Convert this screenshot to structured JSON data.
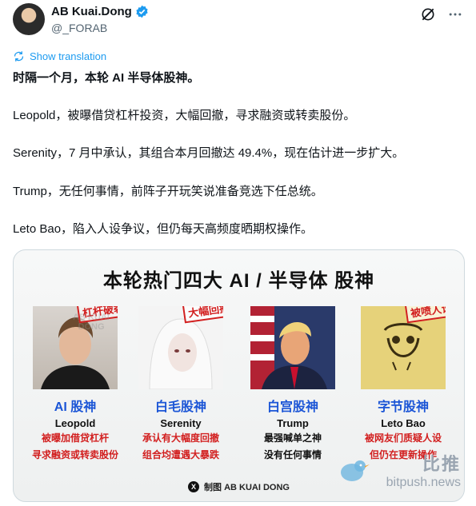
{
  "header": {
    "display_name": "AB Kuai.Dong",
    "handle": "@_FORAB"
  },
  "translation": {
    "label": "Show translation"
  },
  "tweet": {
    "lines": [
      "时隔一个月，本轮 AI 半导体股神。",
      "Leopold，被曝借贷杠杆投资，大幅回撤，寻求融资或转卖股份。",
      "Serenity，7 月中承认，其组合本月回撤达 49.4%，现在估计进一步扩大。",
      "Trump，无任何事情，前阵子开玩笑说准备竞选下任总统。",
      "Leto Bao，陷入人设争议，但仍每天高频度晒期权操作。"
    ]
  },
  "card": {
    "title": "本轮热门四大 AI / 半导体 股神",
    "people": [
      {
        "stamp": "杠杆破裂",
        "title": "AI 股神",
        "name": "Leopold",
        "desc1": "被曝加借贷杠杆",
        "desc2": "寻求融资或转卖股份"
      },
      {
        "stamp": "大幅回撤",
        "title": "白毛股神",
        "name": "Serenity",
        "desc1": "承认有大幅度回撤",
        "desc2": "组合均遭遇大暴跌"
      },
      {
        "stamp": "",
        "title": "白宫股神",
        "name": "Trump",
        "desc1": "最强喊单之神",
        "desc2": "没有任何事情"
      },
      {
        "stamp": "被喷人设",
        "title": "字节股神",
        "name": "Leto Bao",
        "desc1": "被网友们质疑人设",
        "desc2": "但仍在更新操作"
      }
    ],
    "credit": "制图 AB KUAI DONG",
    "watermark": "AB KUAI DONG"
  },
  "overlay_watermark": {
    "cn": "比推",
    "en": "bitpush.news"
  },
  "colors": {
    "link": "#1d9bf0",
    "verified": "#1d9bf0",
    "stamp_red": "#d21f1f",
    "title_blue": "#1b55d6"
  }
}
